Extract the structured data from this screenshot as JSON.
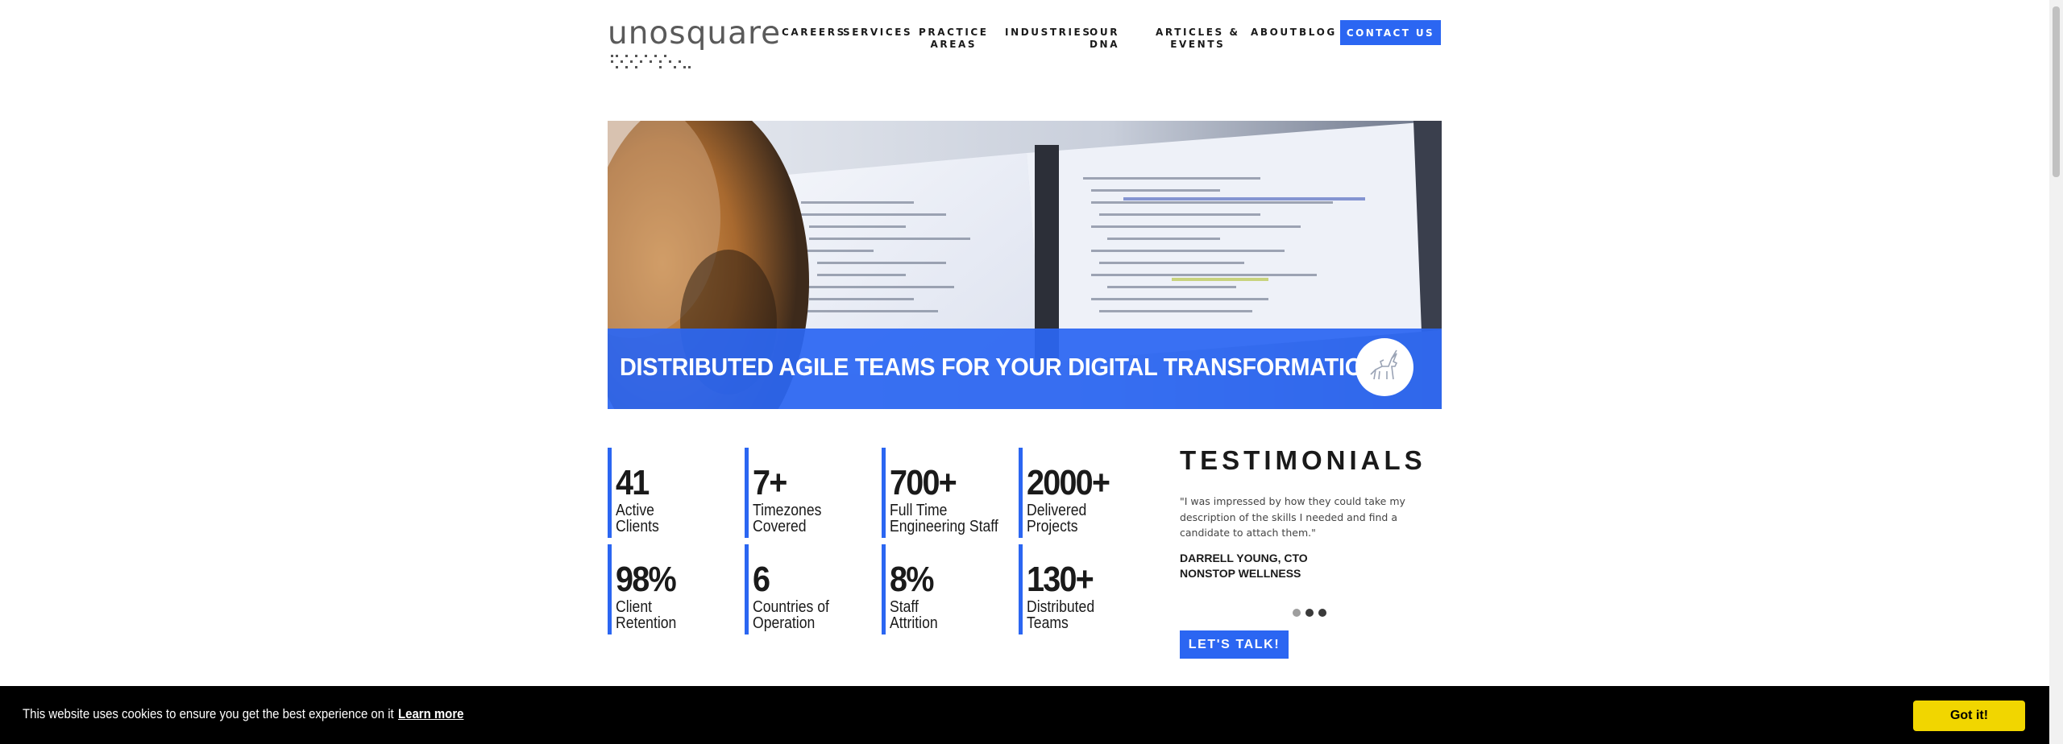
{
  "header": {
    "logo_text": "unosquare",
    "nav": [
      {
        "label": "CAREERS"
      },
      {
        "label": "SERVICES"
      },
      {
        "label": "PRACTICE\nAREAS"
      },
      {
        "label": "INDUSTRIES"
      },
      {
        "label": "OUR\nDNA"
      },
      {
        "label": "ARTICLES &\nEVENTS"
      },
      {
        "label": "ABOUT"
      },
      {
        "label": "BLOG"
      }
    ],
    "contact_label": "CONTACT US"
  },
  "hero": {
    "title": "DISTRIBUTED AGILE TEAMS FOR YOUR DIGITAL TRANSFORMATION",
    "badge_icon": "unicorn-icon"
  },
  "stats": [
    {
      "value": "41",
      "label": "Active\nClients"
    },
    {
      "value": "7+",
      "label": "Timezones\nCovered"
    },
    {
      "value": "700+",
      "label": "Full Time\nEngineering Staff"
    },
    {
      "value": "2000+",
      "label": "Delivered\nProjects"
    },
    {
      "value": "98%",
      "label": "Client\nRetention"
    },
    {
      "value": "6",
      "label": "Countries of\nOperation"
    },
    {
      "value": "8%",
      "label": "Staff\nAttrition"
    },
    {
      "value": "130+",
      "label": "Distributed\nTeams"
    }
  ],
  "testimonials": {
    "title": "TESTIMONIALS",
    "quote": "\"I was impressed by how they could take my description of the skills I needed and find a candidate to attach them.\"",
    "author_name": "DARRELL YOUNG, CTO",
    "author_company": "NONSTOP WELLNESS",
    "active_slide": 2,
    "slide_count": 3,
    "cta_label": "LET'S TALK!"
  },
  "cookie": {
    "message": "This website uses cookies to ensure you get the best experience on it",
    "learn_more": "Learn more",
    "accept_label": "Got it!"
  },
  "colors": {
    "accent": "#2b66f2",
    "cookie_bg": "#000000",
    "cookie_button": "#f1d600"
  }
}
